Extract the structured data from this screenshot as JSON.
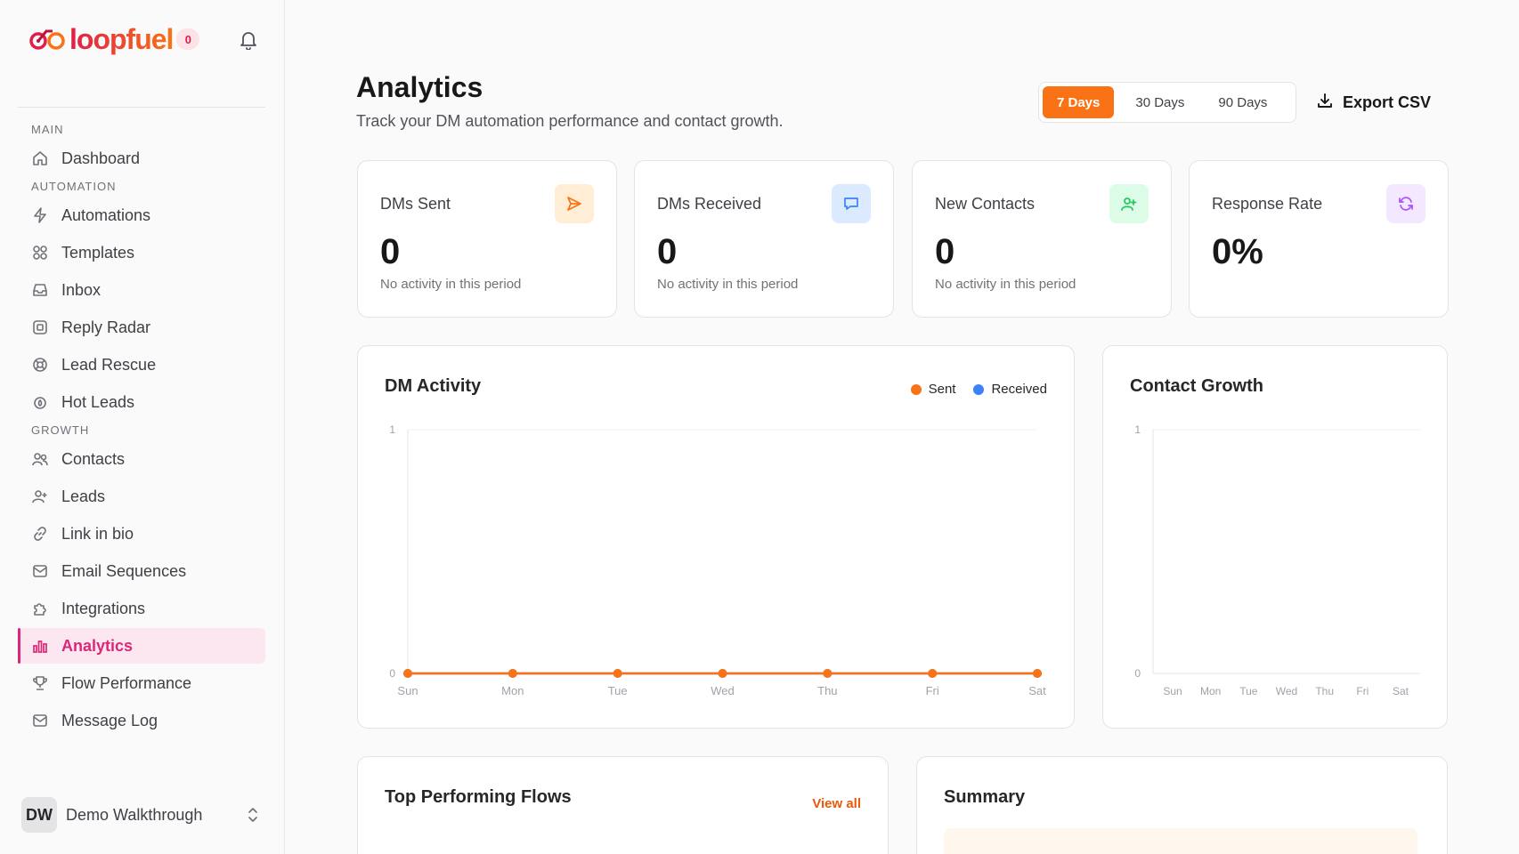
{
  "brand": {
    "name": "loopfuel",
    "badge": "0"
  },
  "sidebar": {
    "sections": [
      {
        "label": "MAIN",
        "items": [
          {
            "label": "Dashboard",
            "icon": "home-icon"
          }
        ]
      },
      {
        "label": "AUTOMATION",
        "items": [
          {
            "label": "Automations",
            "icon": "bolt-icon"
          },
          {
            "label": "Templates",
            "icon": "grid-icon"
          },
          {
            "label": "Inbox",
            "icon": "inbox-icon"
          },
          {
            "label": "Reply Radar",
            "icon": "radar-icon"
          },
          {
            "label": "Lead Rescue",
            "icon": "lifebuoy-icon"
          },
          {
            "label": "Hot Leads",
            "icon": "flame-icon"
          }
        ]
      },
      {
        "label": "GROWTH",
        "items": [
          {
            "label": "Contacts",
            "icon": "users-icon"
          },
          {
            "label": "Leads",
            "icon": "user-plus-icon"
          },
          {
            "label": "Link in bio",
            "icon": "link-icon"
          },
          {
            "label": "Email Sequences",
            "icon": "mail-icon"
          },
          {
            "label": "Integrations",
            "icon": "puzzle-icon"
          },
          {
            "label": "Analytics",
            "icon": "bar-chart-icon",
            "active": true
          },
          {
            "label": "Flow Performance",
            "icon": "trophy-icon"
          },
          {
            "label": "Message Log",
            "icon": "mail-icon"
          }
        ]
      }
    ],
    "user": {
      "initials": "DW",
      "name": "Demo Walkthrough"
    }
  },
  "header": {
    "title": "Analytics",
    "subtitle": "Track your DM automation performance and contact growth.",
    "ranges": [
      "7 Days",
      "30 Days",
      "90 Days"
    ],
    "active_range": "7 Days",
    "export_label": "Export CSV"
  },
  "stats": [
    {
      "label": "DMs Sent",
      "value": "0",
      "note": "No activity in this period",
      "icon": "send-icon",
      "icon_bg": "#ffedd5",
      "icon_color": "#f97316"
    },
    {
      "label": "DMs Received",
      "value": "0",
      "note": "No activity in this period",
      "icon": "message-icon",
      "icon_bg": "#dbeafe",
      "icon_color": "#3b82f6"
    },
    {
      "label": "New Contacts",
      "value": "0",
      "note": "No activity in this period",
      "icon": "user-plus-icon",
      "icon_bg": "#dcfce7",
      "icon_color": "#22c55e"
    },
    {
      "label": "Response Rate",
      "value": "0%",
      "note": "",
      "icon": "refresh-icon",
      "icon_bg": "#f3e8ff",
      "icon_color": "#a855f7"
    }
  ],
  "chart_data": [
    {
      "type": "line",
      "title": "DM Activity",
      "categories": [
        "Sun",
        "Mon",
        "Tue",
        "Wed",
        "Thu",
        "Fri",
        "Sat"
      ],
      "series": [
        {
          "name": "Sent",
          "values": [
            0,
            0,
            0,
            0,
            0,
            0,
            0
          ],
          "color": "#f97316"
        },
        {
          "name": "Received",
          "values": [
            0,
            0,
            0,
            0,
            0,
            0,
            0
          ],
          "color": "#3b82f6"
        }
      ],
      "ylim": [
        0,
        1
      ],
      "yticks": [
        "0",
        "1"
      ],
      "legend": "top-right"
    },
    {
      "type": "line",
      "title": "Contact Growth",
      "categories": [
        "Sun",
        "Mon",
        "Tue",
        "Wed",
        "Thu",
        "Fri",
        "Sat"
      ],
      "series": [],
      "ylim": [
        0,
        1
      ],
      "yticks": [
        "0",
        "1"
      ]
    }
  ],
  "flows": {
    "title": "Top Performing Flows",
    "view_all": "View all"
  },
  "summary": {
    "title": "Summary"
  }
}
